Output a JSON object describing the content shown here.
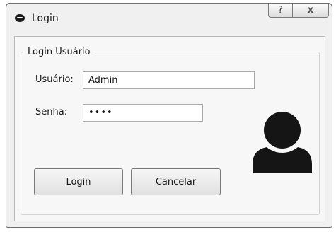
{
  "window": {
    "title": "Login",
    "help_glyph": "?",
    "close_glyph": "x"
  },
  "form": {
    "group_title": "Login Usuário",
    "username_label": "Usuário:",
    "username_value": "Admin",
    "password_label": "Senha:",
    "password_value": "1234"
  },
  "buttons": {
    "login_label": "Login",
    "cancel_label": "Cancelar"
  },
  "icons": {
    "app": "app-icon",
    "user": "user-avatar-icon"
  }
}
